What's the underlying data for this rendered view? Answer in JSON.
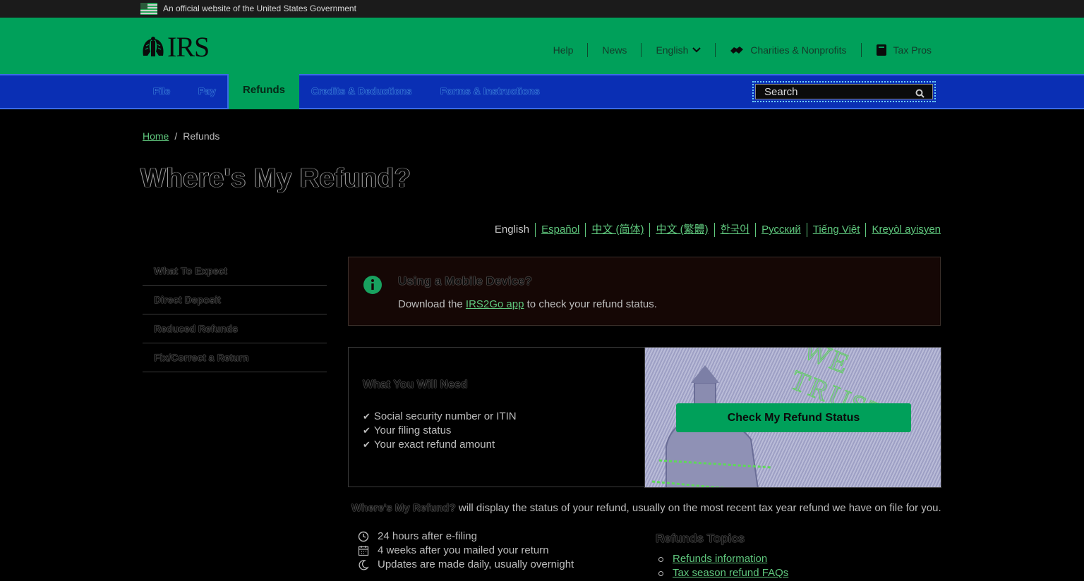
{
  "gov_banner": {
    "text": "An official website of the United States Government"
  },
  "header": {
    "logo_text": "IRS",
    "util_nav": {
      "help": "Help",
      "news": "News",
      "language": "English",
      "charities": "Charities & Nonprofits",
      "tax_pros": "Tax Pros"
    }
  },
  "main_nav": {
    "items": [
      "File",
      "Pay",
      "Refunds",
      "Credits & Deductions",
      "Forms & Instructions"
    ],
    "active": "Refunds",
    "search_placeholder": "Search"
  },
  "breadcrumb": {
    "home": "Home",
    "separator": "/",
    "current": "Refunds"
  },
  "page_title": "Where's My Refund?",
  "languages": [
    "English",
    "Español",
    "中文 (简体)",
    "中文 (繁體)",
    "한국어",
    "Русский",
    "Tiếng Việt",
    "Kreyòl ayisyen"
  ],
  "side_nav": [
    "What To Expect",
    "Direct Deposit",
    "Reduced Refunds",
    "Fix/Correct a Return"
  ],
  "info_box": {
    "title": "Using a Mobile Device?",
    "body_prefix": "Download the ",
    "link": "IRS2Go app",
    "body_suffix": " to check your refund status."
  },
  "card": {
    "need_title": "What You Will Need",
    "needs": [
      "Social security number or ITIN",
      "Your filing status",
      "Your exact refund amount"
    ],
    "cta": "Check My Refund Status",
    "image_text": "WE TRUST"
  },
  "statement": {
    "bold": "Where's My Refund?",
    "rest": " will display the status of your refund, usually on the most recent tax year refund we have on file for you."
  },
  "timing": [
    "24 hours after e-filing",
    "4 weeks after you mailed your return",
    "Updates are made daily, usually overnight"
  ],
  "topics": {
    "title": "Refunds Topics",
    "links": [
      "Refunds information",
      "Tax season refund FAQs"
    ]
  },
  "colors": {
    "header_green": "#00a05a",
    "nav_blue": "#0a2fb4",
    "link_green": "#5fc77d"
  }
}
